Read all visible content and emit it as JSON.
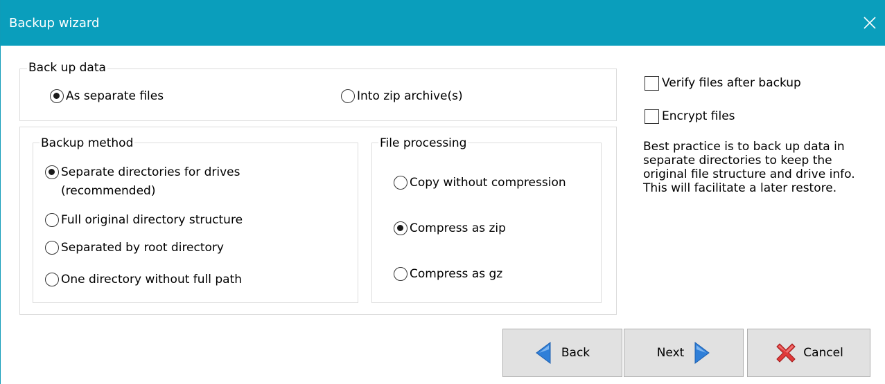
{
  "window": {
    "title": "Backup wizard"
  },
  "backup_data": {
    "legend": "Back up data",
    "options": [
      {
        "label": "As separate files",
        "checked": true
      },
      {
        "label": "Into zip archive(s)",
        "checked": false
      }
    ]
  },
  "backup_method": {
    "legend": "Backup method",
    "options": [
      {
        "label_line1": "Separate directories for drives",
        "label_line2": "(recommended)",
        "checked": true
      },
      {
        "label": "Full original directory structure",
        "checked": false
      },
      {
        "label": "Separated by root directory",
        "checked": false
      },
      {
        "label": "One directory without full path",
        "checked": false
      }
    ]
  },
  "file_processing": {
    "legend": "File processing",
    "options": [
      {
        "label": "Copy without compression",
        "checked": false
      },
      {
        "label": "Compress as zip",
        "checked": true
      },
      {
        "label": "Compress as gz",
        "checked": false
      }
    ]
  },
  "options": {
    "verify_label": "Verify files after backup",
    "verify_checked": false,
    "encrypt_label": "Encrypt files",
    "encrypt_checked": false
  },
  "info": {
    "text": "Best practice is to back up data in separate directories to keep the original file structure and drive info. This will facilitate a later restore."
  },
  "buttons": {
    "back": "Back",
    "next": "Next",
    "cancel": "Cancel"
  },
  "colors": {
    "titlebar": "#0a9ebc",
    "arrow_blue": "#2f7fd8",
    "cancel_red": "#e03a3a"
  },
  "icons": {
    "close": "close-icon",
    "back": "arrow-left-icon",
    "next": "arrow-right-icon",
    "cancel": "red-x-icon"
  }
}
